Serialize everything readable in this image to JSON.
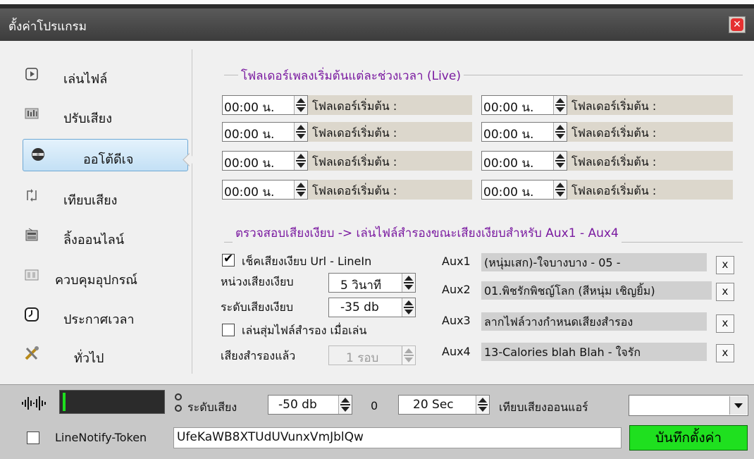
{
  "window": {
    "title": "ตั้งค่าโปรแกรม"
  },
  "sidebar": {
    "items": [
      {
        "label": "เล่นไฟล์",
        "icon": "play-file-icon"
      },
      {
        "label": "ปรับเสียง",
        "icon": "equalizer-icon"
      },
      {
        "label": "ออโต้ดีเจ",
        "icon": "autodj-icon",
        "active": true
      },
      {
        "label": "เทียบเสียง",
        "icon": "compare-icon"
      },
      {
        "label": "ลิ้งออนไลน์",
        "icon": "radio-icon"
      },
      {
        "label": "ควบคุมอุปกรณ์",
        "icon": "device-icon"
      },
      {
        "label": "ประกาศเวลา",
        "icon": "clock-icon"
      },
      {
        "label": "ทั่วไป",
        "icon": "tools-icon"
      }
    ]
  },
  "schedule": {
    "title": "โฟลเดอร์เพลงเริ่มต้นแต่ละช่วงเวลา (Live)",
    "rows": [
      {
        "left_time": "00:00 น.",
        "left_label": "โฟลเดอร์เริ่มต้น :",
        "right_time": "00:00 น.",
        "right_label": "โฟลเดอร์เริ่มต้น :"
      },
      {
        "left_time": "00:00 น.",
        "left_label": "โฟลเดอร์เริ่มต้น :",
        "right_time": "00:00 น.",
        "right_label": "โฟลเดอร์เริ่มต้น :"
      },
      {
        "left_time": "00:00 น.",
        "left_label": "โฟลเดอร์เริ่มต้น :",
        "right_time": "00:00 น.",
        "right_label": "โฟลเดอร์เริ่มต้น :"
      },
      {
        "left_time": "00:00 น.",
        "left_label": "โฟลเดอร์เริ่มต้น :",
        "right_time": "00:00 น.",
        "right_label": "โฟลเดอร์เริ่มต้น :"
      }
    ]
  },
  "silence": {
    "title": "ตรวจสอบเสียงเงียบ -> เล่นไฟล์สำรองขณะเสียงเงียบสำหรับ Aux1 - Aux4",
    "check_label": "เช็คเสียงเงียบ  Url - LineIn",
    "delay_label": "หน่วงเสียงเงียบ",
    "delay_value": "5   วินาที",
    "level_label": "ระดับเสียงเงียบ",
    "level_value": "-35   db",
    "random_label": "เล่นสุ่มไฟล์สำรอง   เมื่อเล่น",
    "after_label": "เสียงสำรองแล้ว",
    "after_value": "1   รอบ"
  },
  "aux": [
    {
      "name": "Aux1",
      "file": "(หนุ่มเสก)-ใจบางบาง - 05 -",
      "clear": "x"
    },
    {
      "name": "Aux2",
      "file": "01.พิชรักพิชญ์โลก (สีหนุ่ม เชิญยิ้ม)",
      "clear": "x"
    },
    {
      "name": "Aux3",
      "file": "ลากไฟล์วางกำหนดเสียงสำรอง",
      "clear": "x"
    },
    {
      "name": "Aux4",
      "file": "13-Calories blah Blah - ใจรัก",
      "clear": "x"
    }
  ],
  "bottom": {
    "level_label": "ระดับเสียง",
    "level_value": "-50  db",
    "zero": "0",
    "sec_value": "20  Sec",
    "compare_label": "เทียบเสียงออนแอร์",
    "compare_select": "",
    "token_label": "LineNotify-Token",
    "token_value": "UfeKaWB8XTUdUVunxVmJblQw",
    "save_label": "บันทึกตั้งค่า"
  }
}
